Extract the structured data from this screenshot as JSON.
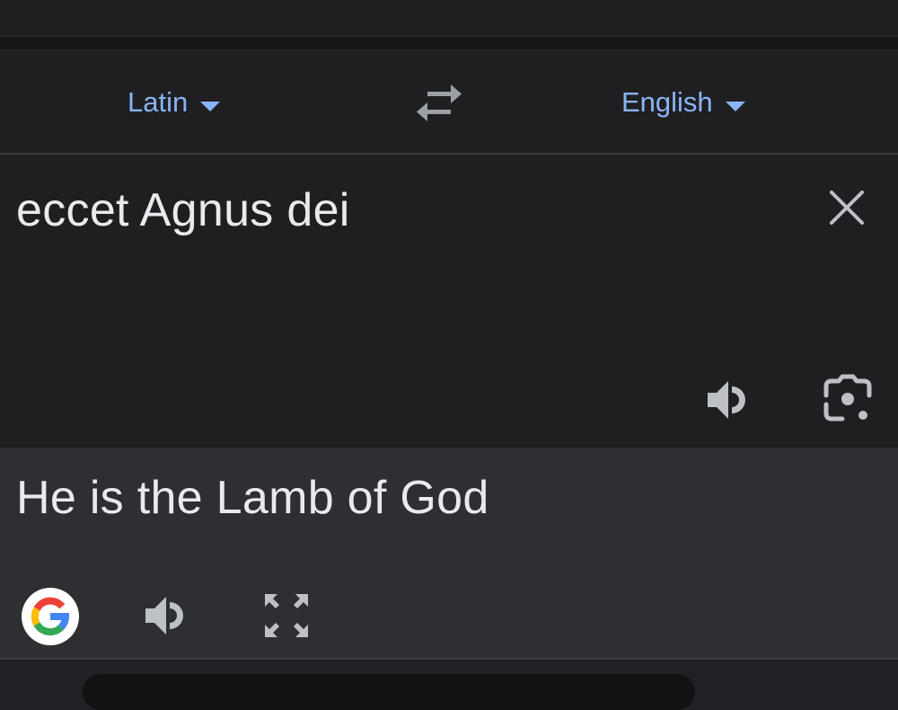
{
  "languages": {
    "source": "Latin",
    "target": "English"
  },
  "input": {
    "text": "eccet Agnus dei"
  },
  "output": {
    "text": "He is the Lamb of God"
  },
  "icons": {
    "swap": "swap-languages-icon",
    "clear": "close-icon",
    "speak": "speaker-icon",
    "camera": "camera-lens-icon",
    "google": "google-logo-icon",
    "fullscreen": "fullscreen-icon"
  },
  "colors": {
    "accent": "#8ab4f8",
    "text": "#e8eaed",
    "icon": "#bdc1c6",
    "background": "#1f1f21",
    "output_background": "#2e2f33"
  }
}
